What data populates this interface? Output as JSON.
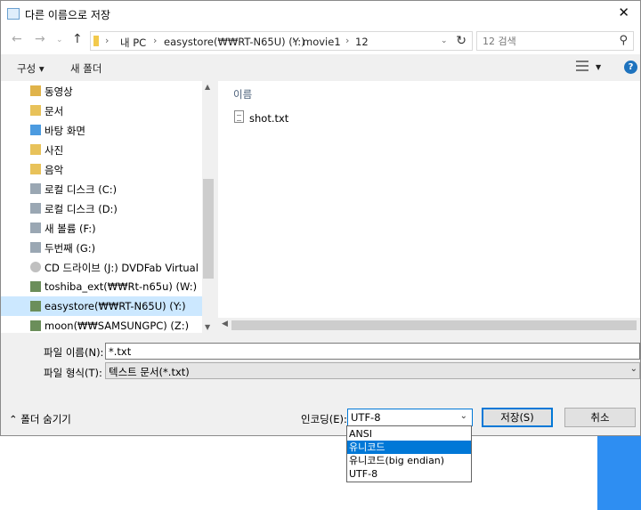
{
  "window": {
    "title": "다른 이름으로 저장"
  },
  "address": {
    "crumbs": [
      "내 PC",
      "easystore(₩₩RT-N65U) (Y:)",
      "movie1",
      "12"
    ],
    "search_placeholder": "12 검색"
  },
  "toolbar": {
    "organize": "구성 ▾",
    "new_folder": "새 폴더"
  },
  "nav": {
    "items": [
      {
        "label": "동영상",
        "icon": "video-folder-icon"
      },
      {
        "label": "문서",
        "icon": "documents-folder-icon"
      },
      {
        "label": "바탕 화면",
        "icon": "desktop-folder-icon"
      },
      {
        "label": "사진",
        "icon": "pictures-folder-icon"
      },
      {
        "label": "음악",
        "icon": "music-folder-icon"
      },
      {
        "label": "로컬 디스크 (C:)",
        "icon": "drive-icon"
      },
      {
        "label": "로컬 디스크 (D:)",
        "icon": "drive-icon"
      },
      {
        "label": "새 볼륨 (F:)",
        "icon": "drive-icon"
      },
      {
        "label": "두번째 (G:)",
        "icon": "drive-icon"
      },
      {
        "label": "CD 드라이브 (J:) DVDFab Virtual Dri",
        "icon": "cd-drive-icon"
      },
      {
        "label": "toshiba_ext(₩₩Rt-n65u) (W:)",
        "icon": "network-drive-icon"
      },
      {
        "label": "easystore(₩₩RT-N65U) (Y:)",
        "icon": "network-drive-icon",
        "selected": true
      },
      {
        "label": "moon(₩₩SAMSUNGPC) (Z:)",
        "icon": "network-drive-icon"
      }
    ]
  },
  "files": {
    "column_header": "이름",
    "items": [
      {
        "name": "shot.txt",
        "icon": "text-file-icon"
      }
    ]
  },
  "form": {
    "filename_label": "파일 이름(N):",
    "filename_value": "*.txt",
    "filetype_label": "파일 형식(T):",
    "filetype_value": "텍스트 문서(*.txt)",
    "hide_folders": "폴더 숨기기",
    "encoding_label": "인코딩(E):",
    "encoding_value": "UTF-8",
    "save_button": "저장(S)",
    "cancel_button": "취소"
  },
  "encoding_options": [
    "ANSI",
    "유니코드",
    "유니코드(big endian)",
    "UTF-8"
  ],
  "encoding_highlighted": "유니코드",
  "colors": {
    "accent": "#0078d7",
    "selection": "#cce8ff",
    "desktop_blue": "#2e8ef2"
  }
}
